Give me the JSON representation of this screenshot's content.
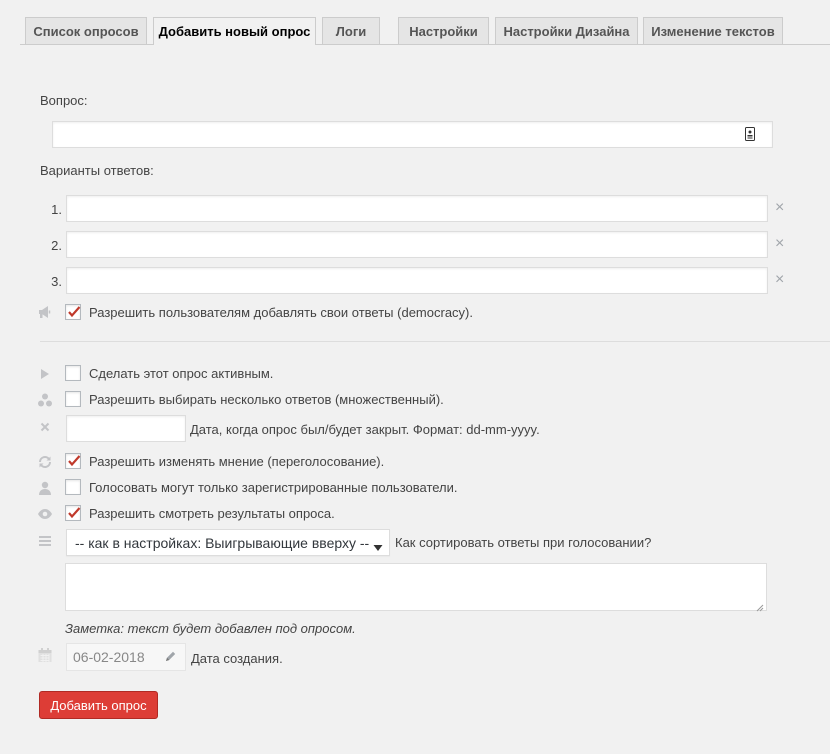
{
  "tabs": [
    {
      "label": "Список опросов"
    },
    {
      "label": "Добавить новый опрос"
    },
    {
      "label": "Логи"
    },
    {
      "label": "Настройки"
    },
    {
      "label": "Настройки Дизайна"
    },
    {
      "label": "Изменение текстов"
    }
  ],
  "active_tab": "Добавить новый опрос",
  "question": {
    "label": "Вопрос:",
    "value": ""
  },
  "answers": {
    "label": "Варианты ответов:",
    "items": [
      {
        "num": "1.",
        "value": ""
      },
      {
        "num": "2.",
        "value": ""
      },
      {
        "num": "3.",
        "value": ""
      }
    ],
    "remove_icon": "×"
  },
  "democracy": {
    "label": "Разрешить пользователям добавлять свои ответы (democracy).",
    "checked": true
  },
  "options": [
    {
      "icon": "play-icon",
      "label": "Сделать этот опрос активным.",
      "checked": false
    },
    {
      "icon": "multiple-icon",
      "label": "Разрешить выбирать несколько ответов (множественный).",
      "checked": false
    },
    {
      "icon": "revote-icon",
      "label": "Разрешить изменять мнение (переголосование).",
      "checked": true
    },
    {
      "icon": "user-icon",
      "label": "Голосовать могут только зарегистрированные пользователи.",
      "checked": false
    },
    {
      "icon": "eye-icon",
      "label": "Разрешить смотреть результаты опроса.",
      "checked": true
    }
  ],
  "close_date": {
    "value": "",
    "label": "Дата, когда опрос был/будет закрыт. Формат: dd-mm-yyyy."
  },
  "sort": {
    "selected": "-- как в настройках: Выигрывающие вверху --",
    "label": "Как сортировать ответы при голосовании?"
  },
  "note": {
    "value": "",
    "hint": "Заметка: текст будет добавлен под опросом."
  },
  "created": {
    "value": "06-02-2018",
    "label": "Дата создания."
  },
  "submit_label": "Добавить опрос",
  "colors": {
    "accent": "#dd3d36",
    "check": "#c0392b",
    "icon": "#c3c4c7"
  }
}
